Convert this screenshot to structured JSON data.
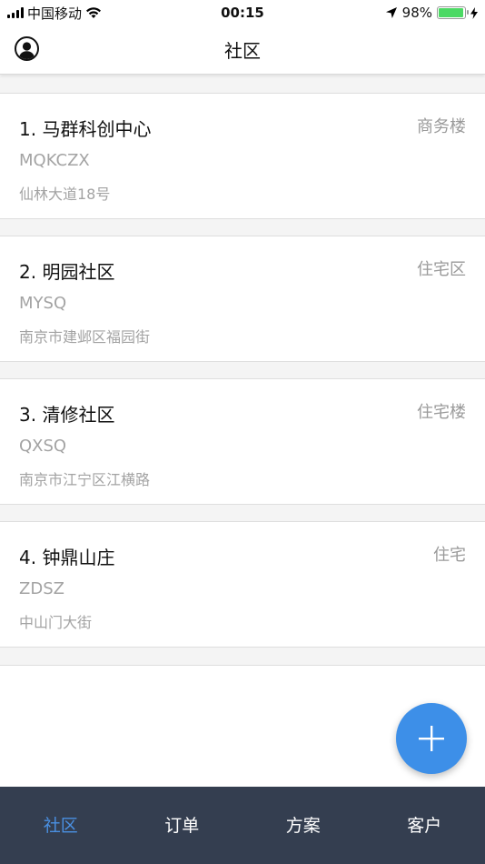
{
  "status_bar": {
    "carrier": "中国移动",
    "time": "00:15",
    "battery_pct": "98%",
    "battery_level": 0.98,
    "battery_color": "#4cd964"
  },
  "nav": {
    "title": "社区",
    "avatar_icon": "user-avatar-icon"
  },
  "communities": [
    {
      "title": "1. 马群科创中心",
      "code": "MQKCZX",
      "address": "仙林大道18号",
      "type": "商务楼"
    },
    {
      "title": "2. 明园社区",
      "code": "MYSQ",
      "address": "南京市建邺区福园街",
      "type": "住宅区"
    },
    {
      "title": "3. 清修社区",
      "code": "QXSQ",
      "address": "南京市江宁区江横路",
      "type": "住宅楼"
    },
    {
      "title": "4. 钟鼎山庄",
      "code": "ZDSZ",
      "address": "中山门大街",
      "type": "住宅"
    }
  ],
  "fab": {
    "icon": "plus-icon",
    "color": "#3d8fe8"
  },
  "tabs": [
    {
      "label": "社区",
      "active": true
    },
    {
      "label": "订单",
      "active": false
    },
    {
      "label": "方案",
      "active": false
    },
    {
      "label": "客户",
      "active": false
    }
  ],
  "colors": {
    "tab_bar_bg": "#343e50",
    "tab_active": "#4a90e2",
    "tab_inactive": "#ffffff"
  }
}
